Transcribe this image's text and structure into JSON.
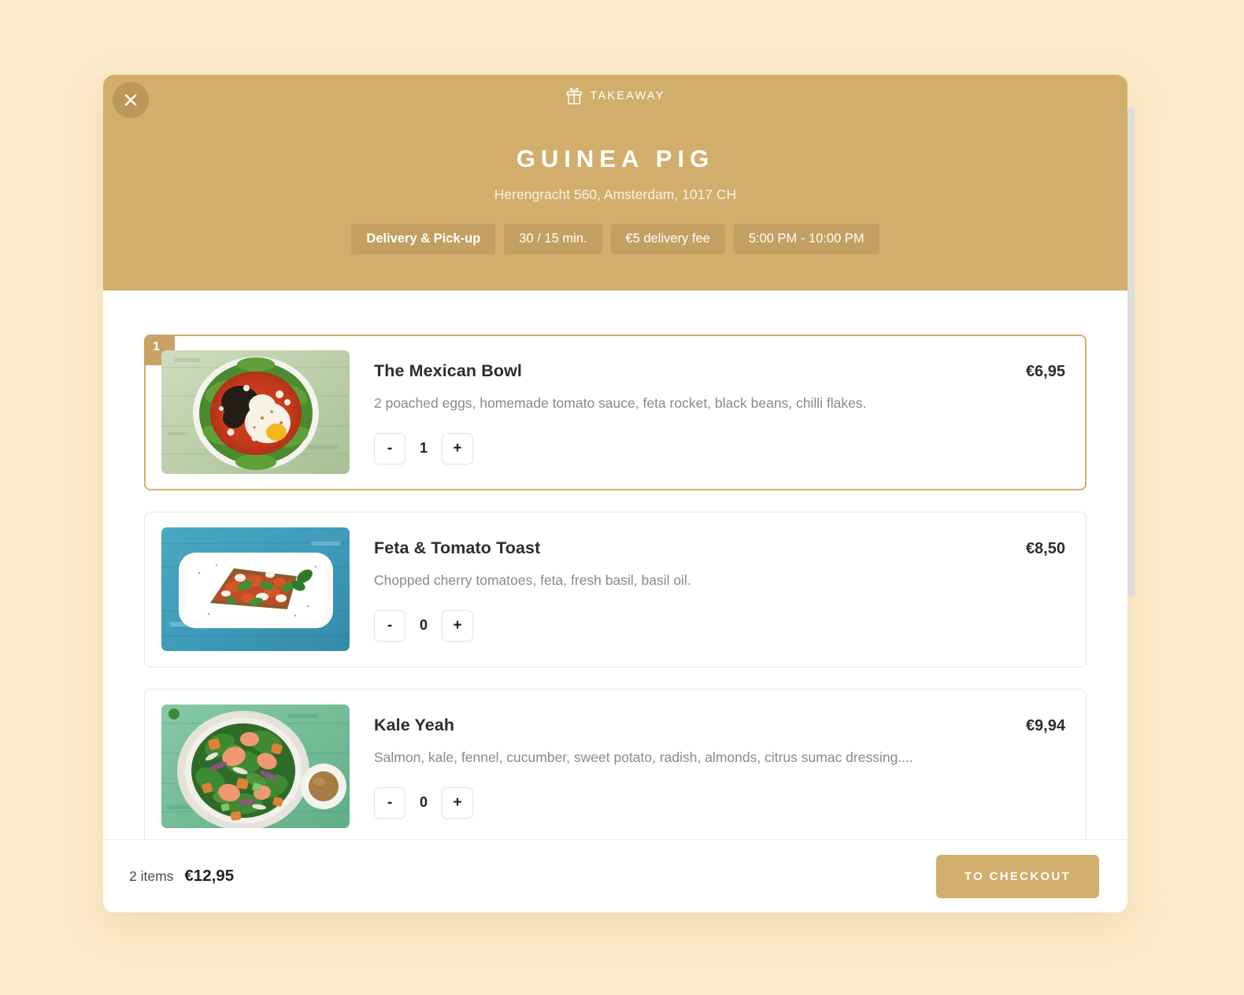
{
  "colors": {
    "page_background": "#FCEBCB",
    "brand_gold": "#D2AE6C",
    "pill_background": "#C3A061",
    "badge_gold": "#C9A365",
    "text_dark": "#2D2D2D",
    "text_muted": "#8A8A8A"
  },
  "header": {
    "close_icon": "close-icon",
    "brand_icon": "gift-icon",
    "brand_label": "TAKEAWAY",
    "restaurant_name": "GUINEA PIG",
    "address": "Herengracht 560, Amsterdam, 1017 CH",
    "pills": [
      {
        "label": "Delivery & Pick-up",
        "primary": true
      },
      {
        "label": "30 / 15 min.",
        "primary": false
      },
      {
        "label": "€5 delivery fee",
        "primary": false
      },
      {
        "label": "5:00 PM - 10:00 PM",
        "primary": false
      }
    ]
  },
  "menu": {
    "items": [
      {
        "badge": "1",
        "name": "The Mexican Bowl",
        "description": "2 poached eggs, homemade tomato sauce, feta rocket, black beans, chilli flakes.",
        "price": "€6,95",
        "quantity": "1",
        "selected": true,
        "decrement_label": "-",
        "increment_label": "+",
        "image_alt": "mexican-bowl-photo"
      },
      {
        "badge": "",
        "name": "Feta & Tomato Toast",
        "description": "Chopped cherry tomatoes, feta, fresh basil, basil oil.",
        "price": "€8,50",
        "quantity": "0",
        "selected": false,
        "decrement_label": "-",
        "increment_label": "+",
        "image_alt": "feta-tomato-toast-photo"
      },
      {
        "badge": "",
        "name": "Kale Yeah",
        "description": "Salmon, kale, fennel, cucumber, sweet potato, radish, almonds, citrus sumac dressing....",
        "price": "€9,94",
        "quantity": "0",
        "selected": false,
        "decrement_label": "-",
        "increment_label": "+",
        "image_alt": "kale-salmon-salad-photo"
      }
    ]
  },
  "footer": {
    "item_count": "2 items",
    "total": "€12,95",
    "checkout_label": "TO CHECKOUT"
  }
}
